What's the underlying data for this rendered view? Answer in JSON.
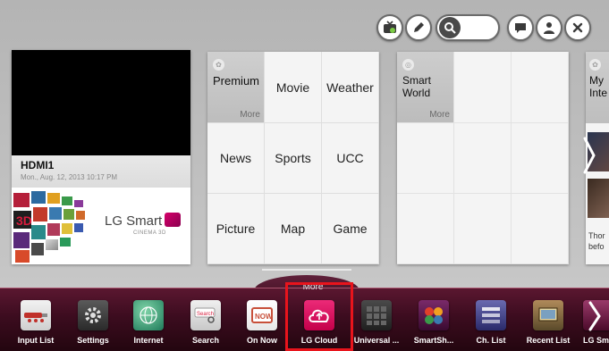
{
  "toolbar": {
    "icons": [
      "tv-network-icon",
      "pencil-icon",
      "search-icon",
      "chat-icon",
      "person-icon",
      "close-icon"
    ]
  },
  "hdmi": {
    "title": "HDMI1",
    "datetime": "Mon., Aug. 12, 2013  10:17 PM",
    "ad_logo": "LG Smart",
    "ad_sub": "CINEMA 3D"
  },
  "premium": {
    "header": "Premium",
    "more": "More",
    "items": [
      "Movie",
      "Weather",
      "News",
      "Sports",
      "UCC",
      "Picture",
      "Map",
      "Game"
    ]
  },
  "smart_world": {
    "header_line1": "Smart",
    "header_line2": "World",
    "more": "More"
  },
  "my_panel": {
    "header_line1": "My",
    "header_line2": "Inte",
    "text_line1": "Thor",
    "text_line2": "befo"
  },
  "launcher": {
    "more_label": "More",
    "apps": [
      {
        "label": "Input List",
        "icon": "input-list-icon",
        "color": "#7a2a2a"
      },
      {
        "label": "Settings",
        "icon": "gear-icon",
        "color": "#3a3a3a"
      },
      {
        "label": "Internet",
        "icon": "globe-icon",
        "color": "#1f7a5a"
      },
      {
        "label": "Search",
        "icon": "search-icon",
        "color": "#6a6a6a"
      },
      {
        "label": "On Now",
        "icon": "on-now-icon",
        "color": "#c8503a"
      },
      {
        "label": "LG Cloud",
        "icon": "cloud-icon",
        "color": "#d8004f"
      },
      {
        "label": "Universal ...",
        "icon": "keypad-icon",
        "color": "#303030"
      },
      {
        "label": "SmartSh...",
        "icon": "smartshare-icon",
        "color": "#8a2a6a"
      },
      {
        "label": "Ch. List",
        "icon": "channel-list-icon",
        "color": "#4a3a8a"
      },
      {
        "label": "Recent List",
        "icon": "recent-list-icon",
        "color": "#6a5a3a"
      },
      {
        "label": "LG Sma",
        "icon": "lg-smart-icon",
        "color": "#7a2a4a"
      }
    ]
  }
}
